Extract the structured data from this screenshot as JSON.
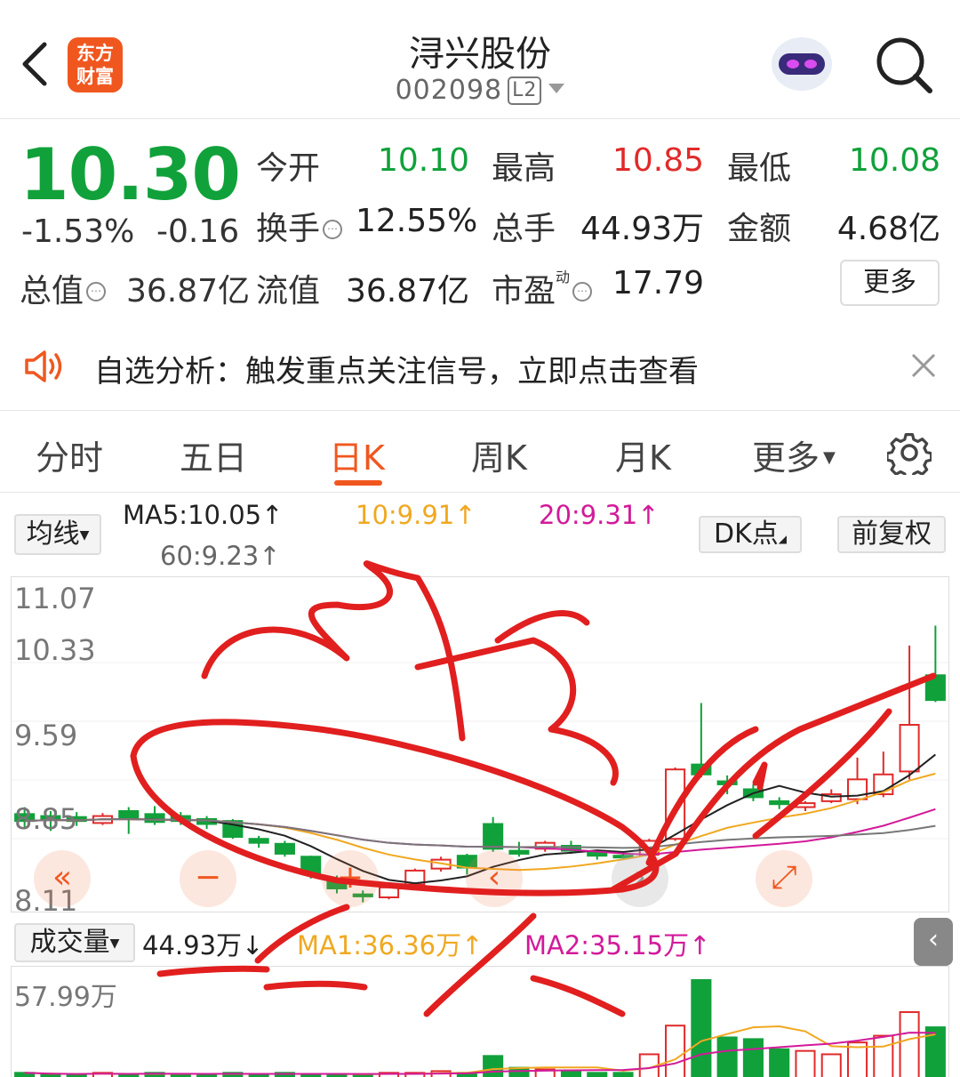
{
  "header": {
    "title": "浔兴股份",
    "code": "002098",
    "level_badge": "L2",
    "logo_line1": "东方",
    "logo_line2": "财富"
  },
  "quote": {
    "price": "10.30",
    "change_pct": "-1.53%",
    "change_amt": "-0.16",
    "open_label": "今开",
    "open": "10.10",
    "high_label": "最高",
    "high": "10.85",
    "low_label": "最低",
    "low": "10.08",
    "turnover_label": "换手",
    "turnover": "12.55%",
    "volume_label": "总手",
    "volume": "44.93万",
    "amount_label": "金额",
    "amount": "4.68亿",
    "mktcap_label": "总值",
    "mktcap": "36.87亿",
    "float_label": "流值",
    "float_cap": "36.87亿",
    "pe_label": "市盈",
    "pe_sup": "动",
    "pe": "17.79",
    "more_label": "更多"
  },
  "notice": {
    "text": "自选分析：触发重点关注信号，立即点击查看"
  },
  "tabs": [
    "分时",
    "五日",
    "日K",
    "周K",
    "月K",
    "更多"
  ],
  "active_tab": "日K",
  "ma_bar": {
    "select_label": "均线",
    "ma5": "MA5:10.05↑",
    "ma10": "10:9.91↑",
    "ma20": "20:9.31↑",
    "ma60": "60:9.23↑",
    "dk_label": "DK点",
    "fq_label": "前复权"
  },
  "price_axis": [
    "11.07",
    "10.33",
    "9.59",
    "8.85",
    "8.11"
  ],
  "volume_bar": {
    "select_label": "成交量",
    "vol": "44.93万↓",
    "ma1": "MA1:36.36万↑",
    "ma2": "MA2:35.15万↑",
    "max_label": "57.99万"
  },
  "colors": {
    "up": "#e02a2a",
    "down": "#11a13b",
    "accent": "#f0571f",
    "ma5": "#222222",
    "ma10": "#f0a820",
    "ma20": "#d21a9a",
    "ma60": "#777777"
  },
  "chart_data": {
    "type": "candlestick",
    "ylim": [
      8.11,
      11.07
    ],
    "candles": [
      {
        "o": 8.95,
        "c": 8.88,
        "h": 9.02,
        "l": 8.8
      },
      {
        "o": 8.93,
        "c": 8.9,
        "h": 8.98,
        "l": 8.78
      },
      {
        "o": 8.92,
        "c": 8.88,
        "h": 8.97,
        "l": 8.83
      },
      {
        "o": 8.86,
        "c": 8.93,
        "h": 8.96,
        "l": 8.84
      },
      {
        "o": 8.98,
        "c": 8.9,
        "h": 9.02,
        "l": 8.75
      },
      {
        "o": 8.95,
        "c": 8.87,
        "h": 9.03,
        "l": 8.84
      },
      {
        "o": 8.93,
        "c": 8.88,
        "h": 8.97,
        "l": 8.84
      },
      {
        "o": 8.9,
        "c": 8.85,
        "h": 8.93,
        "l": 8.8
      },
      {
        "o": 8.88,
        "c": 8.72,
        "h": 8.9,
        "l": 8.7
      },
      {
        "o": 8.7,
        "c": 8.66,
        "h": 8.73,
        "l": 8.61
      },
      {
        "o": 8.65,
        "c": 8.55,
        "h": 8.68,
        "l": 8.52
      },
      {
        "o": 8.52,
        "c": 8.35,
        "h": 8.53,
        "l": 8.3
      },
      {
        "o": 8.3,
        "c": 8.2,
        "h": 8.33,
        "l": 8.15
      },
      {
        "o": 8.14,
        "c": 8.12,
        "h": 8.18,
        "l": 8.06
      },
      {
        "o": 8.11,
        "c": 8.21,
        "h": 8.24,
        "l": 8.09
      },
      {
        "o": 8.24,
        "c": 8.38,
        "h": 8.4,
        "l": 8.2
      },
      {
        "o": 8.4,
        "c": 8.49,
        "h": 8.52,
        "l": 8.37
      },
      {
        "o": 8.53,
        "c": 8.41,
        "h": 8.55,
        "l": 8.34
      },
      {
        "o": 8.85,
        "c": 8.6,
        "h": 8.92,
        "l": 8.57
      },
      {
        "o": 8.58,
        "c": 8.55,
        "h": 8.67,
        "l": 8.52
      },
      {
        "o": 8.6,
        "c": 8.66,
        "h": 8.68,
        "l": 8.57
      },
      {
        "o": 8.63,
        "c": 8.58,
        "h": 8.68,
        "l": 8.55
      },
      {
        "o": 8.56,
        "c": 8.53,
        "h": 8.58,
        "l": 8.49
      },
      {
        "o": 8.53,
        "c": 8.52,
        "h": 8.55,
        "l": 8.49
      },
      {
        "o": 8.54,
        "c": 8.68,
        "h": 8.7,
        "l": 8.52
      },
      {
        "o": 8.7,
        "c": 9.4,
        "h": 9.42,
        "l": 8.68
      },
      {
        "o": 9.45,
        "c": 9.35,
        "h": 10.07,
        "l": 9.32
      },
      {
        "o": 9.28,
        "c": 9.25,
        "h": 9.34,
        "l": 9.15
      },
      {
        "o": 9.2,
        "c": 9.12,
        "h": 9.25,
        "l": 9.08
      },
      {
        "o": 9.08,
        "c": 9.05,
        "h": 9.12,
        "l": 9.0
      },
      {
        "o": 9.02,
        "c": 9.06,
        "h": 9.08,
        "l": 8.98
      },
      {
        "o": 9.08,
        "c": 9.15,
        "h": 9.2,
        "l": 9.06
      },
      {
        "o": 9.1,
        "c": 9.3,
        "h": 9.52,
        "l": 9.05
      },
      {
        "o": 9.15,
        "c": 9.35,
        "h": 9.58,
        "l": 9.12
      },
      {
        "o": 9.38,
        "c": 9.85,
        "h": 10.65,
        "l": 9.3
      },
      {
        "o": 10.35,
        "c": 10.1,
        "h": 10.85,
        "l": 10.08
      }
    ],
    "volumes": [
      3,
      2,
      2,
      3,
      2,
      3,
      2,
      2,
      3,
      2,
      3,
      2,
      2,
      2,
      3,
      3,
      4,
      3,
      13,
      6,
      5,
      4,
      3,
      3,
      14,
      31,
      58,
      24,
      23,
      17,
      16,
      14,
      21,
      25,
      39,
      30
    ]
  }
}
